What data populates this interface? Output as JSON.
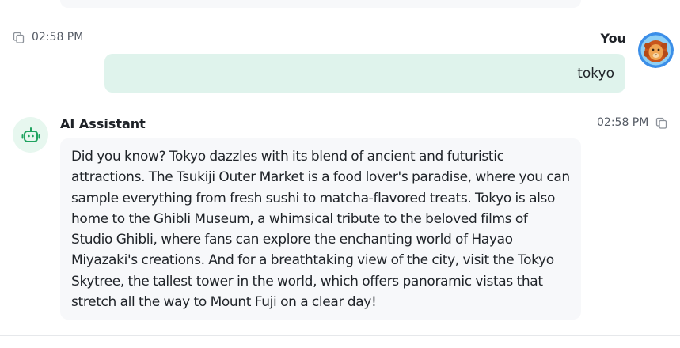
{
  "user_message": {
    "timestamp": "02:58 PM",
    "sender": "You",
    "text": "tokyo",
    "copy_icon": "copy-icon",
    "avatar_icon": "lion-avatar"
  },
  "assistant_message": {
    "sender": "AI Assistant",
    "timestamp": "02:58 PM",
    "copy_icon": "copy-icon",
    "avatar_icon": "robot-icon",
    "text": "Did you know? Tokyo dazzles with its blend of ancient and futuristic attractions. The Tsukiji Outer Market is a food lover's paradise, where you can sample everything from fresh sushi to matcha-flavored treats. Tokyo is also home to the Ghibli Museum, a whimsical tribute to the beloved films of Studio Ghibli, where fans can explore the enchanting world of Hayao Miyazaki's creations. And for a breathtaking view of the city, visit the Tokyo Skytree, the tallest tower in the world, which offers panoramic vistas that stretch all the way to Mount Fuji on a clear day!"
  },
  "colors": {
    "user_bubble": "#dff3ec",
    "assistant_bubble": "#f7f8fa",
    "bot_avatar_bg": "#e7f7ef",
    "bot_icon": "#1fa35f",
    "avatar_ring": "#3b8ee8"
  }
}
